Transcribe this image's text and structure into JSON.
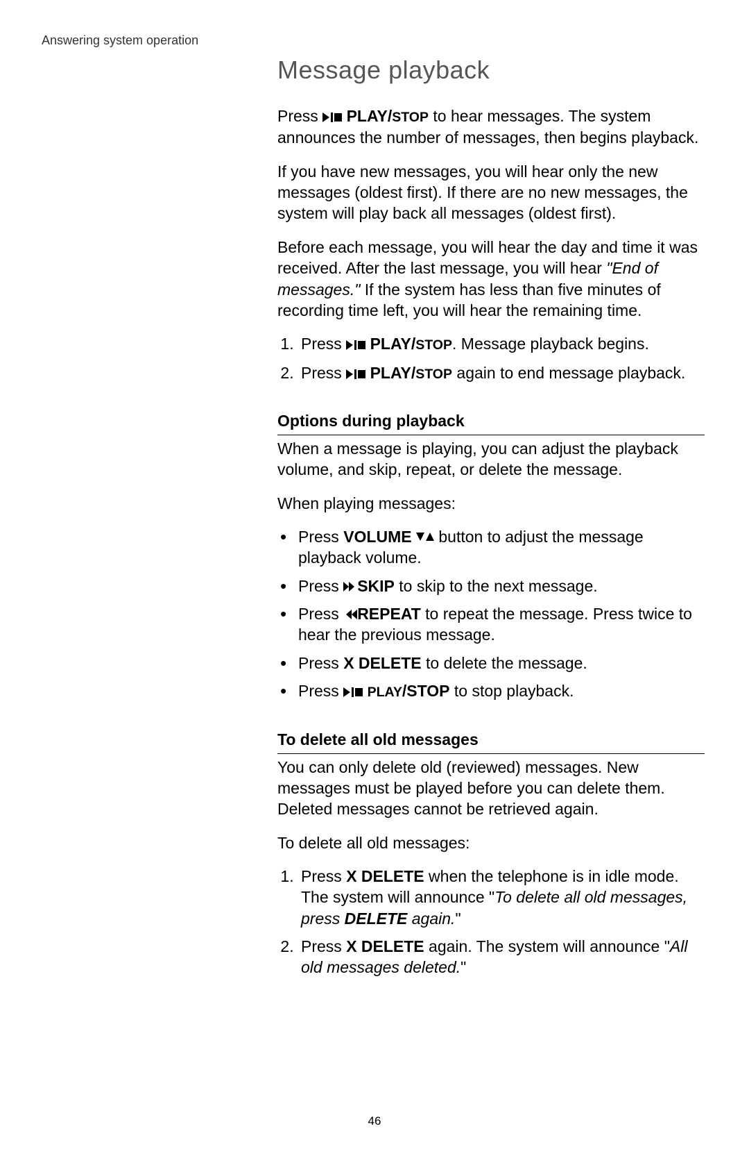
{
  "header": "Answering system operation",
  "title": "Message playback",
  "para1": {
    "pre": "Press ",
    "label_play": "PLAY",
    "label_stop": "STOP",
    "post": " to hear messages. The system announces the number of messages, then begins playback."
  },
  "para2": "If you have new messages, you will hear only the new messages (oldest first). If there are no new messages, the system will play back all messages (oldest first).",
  "para3": {
    "pre": "Before each message, you will hear the day and time it was received. After the last message, you will hear ",
    "quote": "\"End of messages.\"",
    "post": " If the system has less than five minutes of recording time left, you will hear the remaining time."
  },
  "steps1": [
    {
      "pre": "Press ",
      "label_play": "PLAY",
      "label_stop": "STOP",
      "post": ". Message playback begins."
    },
    {
      "pre": "Press ",
      "label_play": "PLAY",
      "label_stop": "STOP",
      "post": " again to end message playback."
    }
  ],
  "section2_heading": "Options during playback",
  "section2_intro": "When a message is playing, you can adjust the playback volume, and skip, repeat, or delete the message.",
  "section2_lead": "When playing messages:",
  "options": [
    {
      "pre": "Press ",
      "bold1": "VOLUME",
      "post": " button to adjust the message playback volume.",
      "icon": "volume"
    },
    {
      "pre": "Press ",
      "bold1": "SKIP",
      "post": " to skip to the next message.",
      "icon": "skip"
    },
    {
      "pre": "Press ",
      "bold1": "REPEAT",
      "post": " to repeat the message. Press twice to hear the previous message.",
      "icon": "repeat"
    },
    {
      "pre": "Press ",
      "bold1": "X DELETE",
      "post": " to delete the message."
    },
    {
      "pre": "Press ",
      "bold_play": "PLAY",
      "bold_stop": "STOP",
      "post": " to stop playback.",
      "icon": "playstop"
    }
  ],
  "section3_heading": "To delete all old messages",
  "section3_intro": "You can only delete old (reviewed) messages. New messages must be played before you can delete them. Deleted messages cannot be retrieved again.",
  "section3_lead": "To delete all old messages:",
  "steps3": [
    {
      "pre": "Press ",
      "bold1": "X DELETE",
      "mid": " when the telephone is in idle mode. The system will announce \"",
      "italic1": "To delete all old messages, press ",
      "italic_bold": "DELETE",
      "italic2": " again.",
      "post": "\""
    },
    {
      "pre": "Press ",
      "bold1": "X DELETE",
      "mid": " again. The system will announce \"",
      "italic1": "All old messages deleted.",
      "post": "\""
    }
  ],
  "page_number": "46"
}
